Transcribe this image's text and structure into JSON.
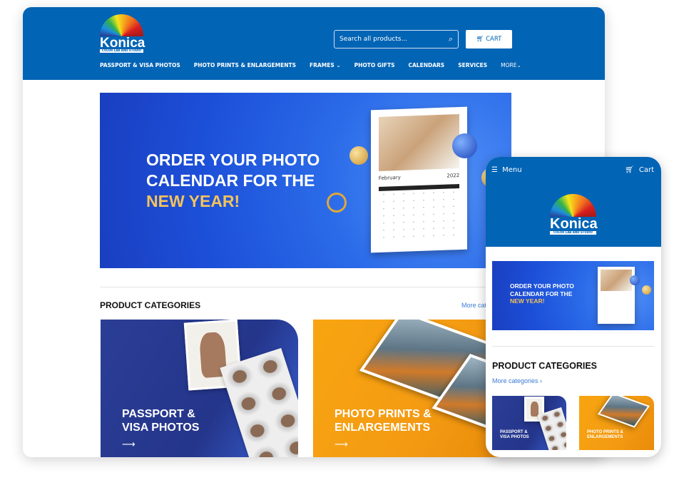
{
  "desktop": {
    "logo": {
      "word": "Konica",
      "sub": "COLOR LAB AND STUDIO"
    },
    "search": {
      "placeholder": "Search all products...",
      "icon": "search-icon"
    },
    "cart_label": "CART",
    "nav": [
      {
        "label": "PASSPORT & VISA PHOTOS"
      },
      {
        "label": "PHOTO PRINTS & ENLARGEMENTS"
      },
      {
        "label": "FRAMES",
        "dropdown": true
      },
      {
        "label": "PHOTO GIFTS"
      },
      {
        "label": "CALENDARS"
      },
      {
        "label": "SERVICES"
      },
      {
        "label": "MORE",
        "dropdown": true
      }
    ],
    "banner": {
      "line1": "ORDER YOUR PHOTO",
      "line2": "CALENDAR FOR THE",
      "line3": "NEW YEAR!",
      "month": "February",
      "year": "2022"
    },
    "section_title": "PRODUCT CATEGORIES",
    "more_link": "More categories ›",
    "cards": [
      {
        "line1": "PASSPORT &",
        "line2": "VISA PHOTOS",
        "arrow": "⟶"
      },
      {
        "line1": "PHOTO PRINTS &",
        "line2": "ENLARGEMENTS",
        "arrow": "⟶"
      }
    ]
  },
  "mobile": {
    "menu_label": "Menu",
    "cart_label": "Cart",
    "section_title": "PRODUCT CATEGORIES",
    "more_link": "More categories ›"
  },
  "colors": {
    "brand_blue": "#0264b5",
    "gold": "#f3c35c",
    "orange": "#f8a511"
  }
}
